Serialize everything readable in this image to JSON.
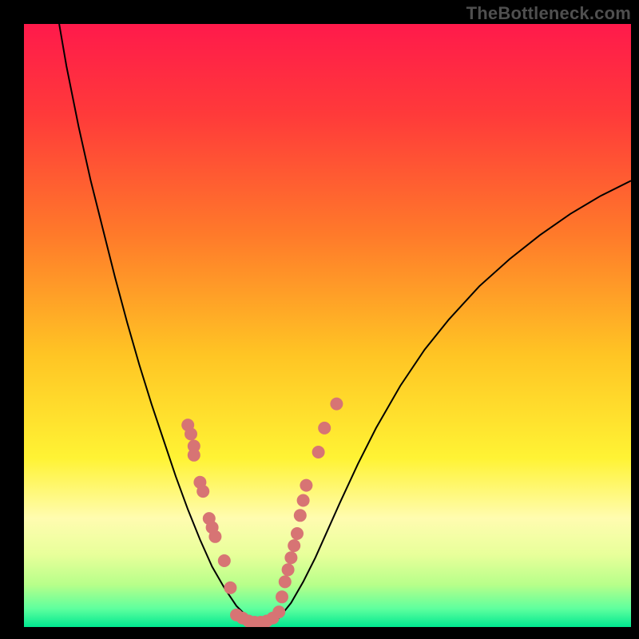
{
  "watermark": "TheBottleneck.com",
  "colors": {
    "background": "#000000",
    "gradient_stops": [
      {
        "offset": 0.0,
        "color": "#ff1a4b"
      },
      {
        "offset": 0.15,
        "color": "#ff3a3a"
      },
      {
        "offset": 0.35,
        "color": "#ff7a2a"
      },
      {
        "offset": 0.55,
        "color": "#ffc524"
      },
      {
        "offset": 0.72,
        "color": "#fff334"
      },
      {
        "offset": 0.82,
        "color": "#fffcb0"
      },
      {
        "offset": 0.88,
        "color": "#e8ff9a"
      },
      {
        "offset": 0.93,
        "color": "#b7ff8a"
      },
      {
        "offset": 0.97,
        "color": "#5dff9e"
      },
      {
        "offset": 1.0,
        "color": "#00e890"
      }
    ],
    "curve": "#000000",
    "markers": "#d77474",
    "watermark_text": "#4f4f4f"
  },
  "chart_data": {
    "type": "line",
    "title": "",
    "xlabel": "",
    "ylabel": "",
    "xlim": [
      0,
      100
    ],
    "ylim": [
      0,
      100
    ],
    "grid": false,
    "curve_points": [
      {
        "x": 5.8,
        "y": 100.0
      },
      {
        "x": 7.0,
        "y": 93.0
      },
      {
        "x": 9.0,
        "y": 83.0
      },
      {
        "x": 11.0,
        "y": 74.0
      },
      {
        "x": 13.0,
        "y": 66.0
      },
      {
        "x": 15.0,
        "y": 58.0
      },
      {
        "x": 17.0,
        "y": 50.5
      },
      {
        "x": 19.0,
        "y": 43.5
      },
      {
        "x": 21.0,
        "y": 37.0
      },
      {
        "x": 23.0,
        "y": 31.0
      },
      {
        "x": 25.0,
        "y": 25.0
      },
      {
        "x": 27.0,
        "y": 19.5
      },
      {
        "x": 29.0,
        "y": 14.5
      },
      {
        "x": 31.0,
        "y": 10.0
      },
      {
        "x": 33.0,
        "y": 6.5
      },
      {
        "x": 35.0,
        "y": 3.5
      },
      {
        "x": 37.0,
        "y": 1.5
      },
      {
        "x": 38.5,
        "y": 0.5
      },
      {
        "x": 40.0,
        "y": 0.5
      },
      {
        "x": 42.0,
        "y": 1.5
      },
      {
        "x": 44.0,
        "y": 4.0
      },
      {
        "x": 46.0,
        "y": 7.5
      },
      {
        "x": 48.0,
        "y": 11.5
      },
      {
        "x": 50.0,
        "y": 16.0
      },
      {
        "x": 52.0,
        "y": 20.5
      },
      {
        "x": 55.0,
        "y": 27.0
      },
      {
        "x": 58.0,
        "y": 33.0
      },
      {
        "x": 62.0,
        "y": 40.0
      },
      {
        "x": 66.0,
        "y": 46.0
      },
      {
        "x": 70.0,
        "y": 51.0
      },
      {
        "x": 75.0,
        "y": 56.5
      },
      {
        "x": 80.0,
        "y": 61.0
      },
      {
        "x": 85.0,
        "y": 65.0
      },
      {
        "x": 90.0,
        "y": 68.5
      },
      {
        "x": 95.0,
        "y": 71.5
      },
      {
        "x": 100.0,
        "y": 74.0
      }
    ],
    "markers_left": [
      {
        "x": 27.0,
        "y": 33.5
      },
      {
        "x": 27.5,
        "y": 32.0
      },
      {
        "x": 28.0,
        "y": 30.0
      },
      {
        "x": 28.0,
        "y": 28.5
      },
      {
        "x": 29.0,
        "y": 24.0
      },
      {
        "x": 29.5,
        "y": 22.5
      },
      {
        "x": 30.5,
        "y": 18.0
      },
      {
        "x": 31.0,
        "y": 16.5
      },
      {
        "x": 31.5,
        "y": 15.0
      },
      {
        "x": 33.0,
        "y": 11.0
      },
      {
        "x": 34.0,
        "y": 6.5
      }
    ],
    "markers_right": [
      {
        "x": 42.5,
        "y": 5.0
      },
      {
        "x": 43.0,
        "y": 7.5
      },
      {
        "x": 43.5,
        "y": 9.5
      },
      {
        "x": 44.0,
        "y": 11.5
      },
      {
        "x": 44.5,
        "y": 13.5
      },
      {
        "x": 45.0,
        "y": 15.5
      },
      {
        "x": 45.5,
        "y": 18.5
      },
      {
        "x": 46.0,
        "y": 21.0
      },
      {
        "x": 46.5,
        "y": 23.5
      },
      {
        "x": 48.5,
        "y": 29.0
      },
      {
        "x": 49.5,
        "y": 33.0
      },
      {
        "x": 51.5,
        "y": 37.0
      }
    ],
    "markers_bottom": [
      {
        "x": 35.0,
        "y": 2.0
      },
      {
        "x": 36.0,
        "y": 1.5
      },
      {
        "x": 37.0,
        "y": 1.0
      },
      {
        "x": 38.0,
        "y": 0.8
      },
      {
        "x": 39.0,
        "y": 0.8
      },
      {
        "x": 40.0,
        "y": 1.0
      },
      {
        "x": 41.0,
        "y": 1.5
      },
      {
        "x": 42.0,
        "y": 2.5
      }
    ]
  }
}
